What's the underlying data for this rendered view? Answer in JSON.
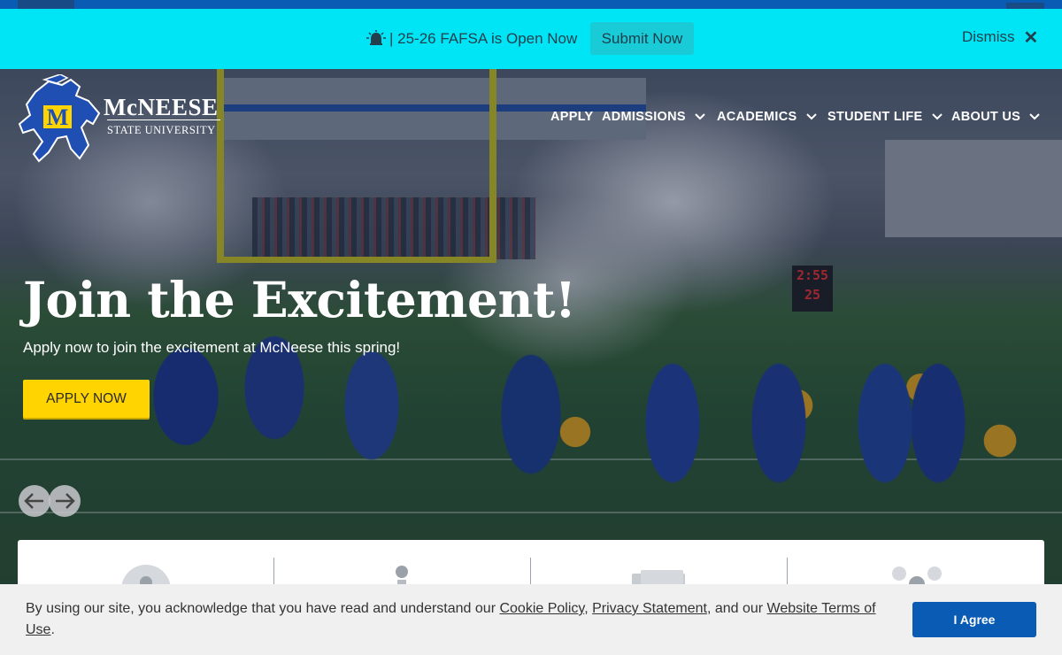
{
  "alert": {
    "message": "| 25-26 FAFSA is Open Now",
    "icon": "alarm-bell-icon",
    "submit_label": "Submit Now",
    "dismiss_label": "Dismiss",
    "background": "#00e5f5"
  },
  "logo": {
    "name": "McNEESE",
    "subtitle": "STATE UNIVERSITY",
    "mark_letter": "M"
  },
  "nav": {
    "items": [
      {
        "label": "APPLY",
        "has_dropdown": false
      },
      {
        "label": "ADMISSIONS",
        "has_dropdown": true
      },
      {
        "label": "ACADEMICS",
        "has_dropdown": true
      },
      {
        "label": "STUDENT LIFE",
        "has_dropdown": true
      },
      {
        "label": "ABOUT US",
        "has_dropdown": true
      }
    ]
  },
  "hero": {
    "title": "Join the Excitement!",
    "subtitle": "Apply now to join the excitement at McNeese this spring!",
    "cta_label": "APPLY NOW",
    "scoreboard_time": "2:55",
    "scoreboard_number": "25"
  },
  "carousel": {
    "prev_icon": "arrow-left-icon",
    "next_icon": "arrow-right-icon"
  },
  "cookie": {
    "text_before": "By using our site, you acknowledge that you have read and understand our ",
    "cookie_policy": "Cookie Policy",
    "sep1": ", ",
    "privacy": "Privacy Statement",
    "sep2": ", and our ",
    "terms": "Website Terms of Use",
    "end": ".",
    "agree_label": "I Agree"
  },
  "colors": {
    "brand_blue": "#0a5bb3",
    "accent_yellow": "#ffd400"
  }
}
